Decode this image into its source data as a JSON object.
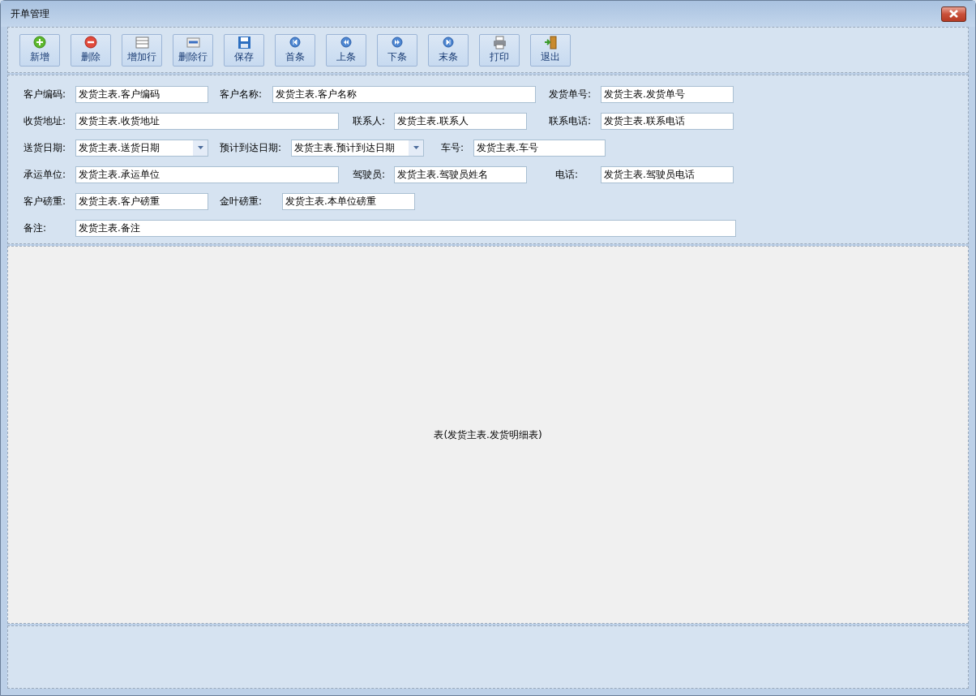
{
  "window": {
    "title": "开单管理"
  },
  "toolbar": [
    {
      "label": "新增",
      "kind": "add"
    },
    {
      "label": "删除",
      "kind": "delete"
    },
    {
      "label": "增加行",
      "kind": "add-row"
    },
    {
      "label": "删除行",
      "kind": "delete-row"
    },
    {
      "label": "保存",
      "kind": "save"
    },
    {
      "label": "首条",
      "kind": "first"
    },
    {
      "label": "上条",
      "kind": "prev"
    },
    {
      "label": "下条",
      "kind": "next"
    },
    {
      "label": "末条",
      "kind": "last"
    },
    {
      "label": "打印",
      "kind": "print"
    },
    {
      "label": "退出",
      "kind": "exit"
    }
  ],
  "form_rows": [
    [
      {
        "label": "客户编码:",
        "value": "发货主表.客户编码",
        "kind": "text"
      },
      {
        "label": "客户名称:",
        "value": "发货主表.客户名称",
        "kind": "text"
      },
      {
        "label": "发货单号:",
        "value": "发货主表.发货单号",
        "kind": "text"
      }
    ],
    [
      {
        "label": "收货地址:",
        "value": "发货主表.收货地址",
        "kind": "text"
      },
      {
        "label": "联系人:",
        "value": "发货主表.联系人",
        "kind": "text"
      },
      {
        "label": "联系电话:",
        "value": "发货主表.联系电话",
        "kind": "text"
      }
    ],
    [
      {
        "label": "送货日期:",
        "value": "发货主表.送货日期",
        "kind": "date"
      },
      {
        "label": "预计到达日期:",
        "value": "发货主表.预计到达日期",
        "kind": "date"
      },
      {
        "label": "车号:",
        "value": "发货主表.车号",
        "kind": "text"
      }
    ],
    [
      {
        "label": "承运单位:",
        "value": "发货主表.承运单位",
        "kind": "text"
      },
      {
        "label": "驾驶员:",
        "value": "发货主表.驾驶员姓名",
        "kind": "text"
      },
      {
        "label": "电话:",
        "value": "发货主表.驾驶员电话",
        "kind": "text"
      }
    ],
    [
      {
        "label": "客户磅重:",
        "value": "发货主表.客户磅重",
        "kind": "text"
      },
      {
        "label": "金叶磅重:",
        "value": "发货主表.本单位磅重",
        "kind": "text"
      }
    ],
    [
      {
        "label": "备注:",
        "value": "发货主表.备注",
        "kind": "text"
      }
    ]
  ],
  "detail_table": {
    "caption": "表(发货主表.发货明细表)"
  }
}
